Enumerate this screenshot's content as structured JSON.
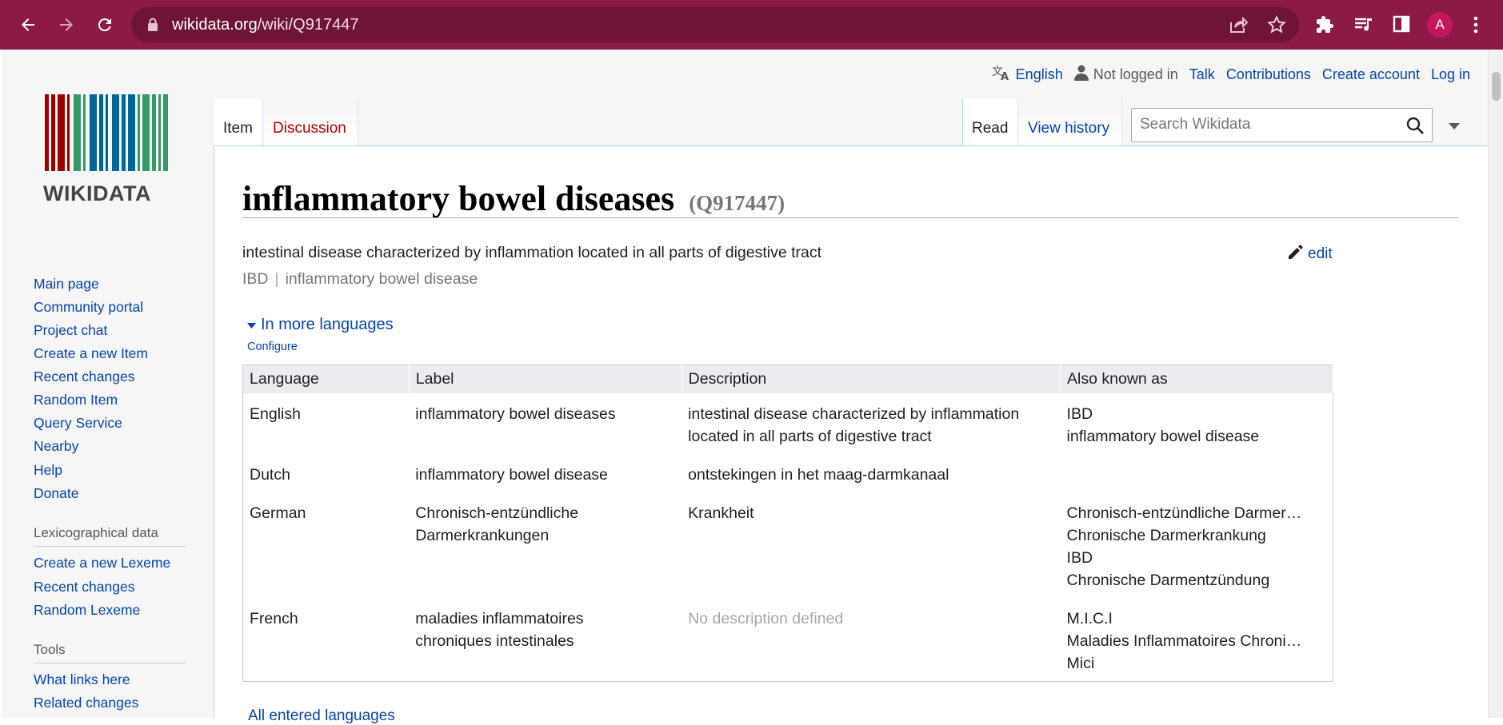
{
  "browser": {
    "url_domain": "wikidata.org",
    "url_path": "/wiki/Q917447",
    "avatar_letter": "A",
    "accent": "#8b1a46"
  },
  "personal": {
    "language": "English",
    "not_logged_in": "Not logged in",
    "talk": "Talk",
    "contributions": "Contributions",
    "create_account": "Create account",
    "log_in": "Log in"
  },
  "logo": {
    "text": "WIKIDATA",
    "colors": [
      "#990000",
      "#339966",
      "#006699"
    ]
  },
  "sidebar": {
    "nav": [
      "Main page",
      "Community portal",
      "Project chat",
      "Create a new Item",
      "Recent changes",
      "Random Item",
      "Query Service",
      "Nearby",
      "Help",
      "Donate"
    ],
    "lexico_heading": "Lexicographical data",
    "lexico": [
      "Create a new Lexeme",
      "Recent changes",
      "Random Lexeme"
    ],
    "tools_heading": "Tools",
    "tools": [
      "What links here",
      "Related changes"
    ]
  },
  "tabs": {
    "item": "Item",
    "discussion": "Discussion",
    "read": "Read",
    "view_history": "View history"
  },
  "search": {
    "placeholder": "Search Wikidata"
  },
  "item": {
    "label": "inflammatory bowel diseases",
    "qid": "(Q917447)",
    "description": "intestinal disease characterized by inflammation located in all parts of digestive tract",
    "aliases": [
      "IBD",
      "inflammatory bowel disease"
    ],
    "edit": "edit",
    "more_languages": "In more languages",
    "configure": "Configure",
    "all_languages": "All entered languages"
  },
  "lang_table": {
    "headers": [
      "Language",
      "Label",
      "Description",
      "Also known as"
    ],
    "rows": [
      {
        "language": "English",
        "label": [
          "inflammatory bowel diseases"
        ],
        "description": [
          "intestinal disease characterized by inflammation",
          "located in all parts of digestive tract"
        ],
        "aka": [
          "IBD",
          "inflammatory bowel disease"
        ]
      },
      {
        "language": "Dutch",
        "label": [
          "inflammatory bowel disease"
        ],
        "description": [
          "ontstekingen in het maag-darmkanaal"
        ],
        "aka": []
      },
      {
        "language": "German",
        "label": [
          "Chronisch-entzündliche",
          "Darmerkrankungen"
        ],
        "description": [
          "Krankheit"
        ],
        "aka": [
          "Chronisch-entzündliche Darmer…",
          "Chronische Darmerkrankung",
          "IBD",
          "Chronische Darmentzündung"
        ]
      },
      {
        "language": "French",
        "label": [
          "maladies inflammatoires",
          "chroniques intestinales"
        ],
        "description": [
          "No description defined"
        ],
        "description_missing": true,
        "aka": [
          "M.I.C.I",
          "Maladies Inflammatoires Chroni…",
          "Mici"
        ]
      }
    ]
  }
}
